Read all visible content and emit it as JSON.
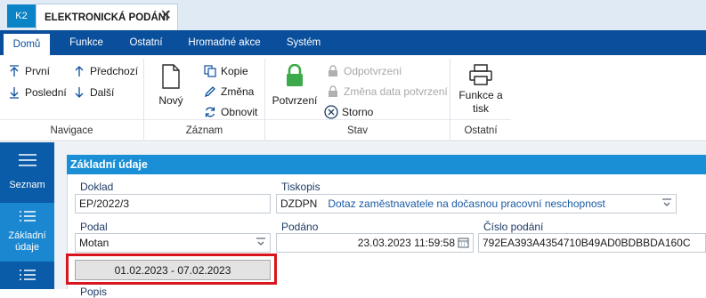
{
  "window": {
    "app_badge": "K2",
    "tab_title": "ELEKTRONICKÁ PODÁNÍ",
    "tab_close": "✕"
  },
  "ribbon_tabs": [
    "Domů",
    "Funkce",
    "Ostatní",
    "Hromadné akce",
    "Systém"
  ],
  "ribbon": {
    "navigace": {
      "caption": "Navigace",
      "first": "První",
      "last": "Poslední",
      "prev": "Předchozí",
      "next": "Další"
    },
    "zaznam": {
      "caption": "Záznam",
      "new": "Nový",
      "copy": "Kopie",
      "change": "Změna",
      "refresh": "Obnovit"
    },
    "stav": {
      "caption": "Stav",
      "confirm": "Potvrzení",
      "unconfirm": "Odpotvrzení",
      "change_date": "Změna data potvrzení",
      "cancel": "Storno"
    },
    "ostatni": {
      "caption": "Ostatní",
      "print_line1": "Funkce a",
      "print_line2": "tisk"
    }
  },
  "leftnav": {
    "list_label": "Seznam",
    "basic_line1": "Základní",
    "basic_line2": "údaje"
  },
  "form": {
    "section_title": "Základní údaje",
    "doklad_label": "Doklad",
    "doklad_value": "EP/2022/3",
    "tiskopis_label": "Tiskopis",
    "tiskopis_code": "DZDPN",
    "tiskopis_name": "Dotaz zaměstnavatele na dočasnou pracovní neschopnost",
    "podal_label": "Podal",
    "podal_value": "Motan",
    "podano_label": "Podáno",
    "podano_value": "23.03.2023 11:59:58",
    "cislo_label": "Číslo podání",
    "cislo_value": "792EA393A4354710B49AD0BDBBDA160C",
    "period": "01.02.2023 - 07.02.2023",
    "next_label": "Popis"
  },
  "colors": {
    "ribbon_blue": "#0a4f9c",
    "header_blue": "#1a8fd6",
    "highlight_red": "#d9141c",
    "confirm_green": "#3caa4b"
  }
}
